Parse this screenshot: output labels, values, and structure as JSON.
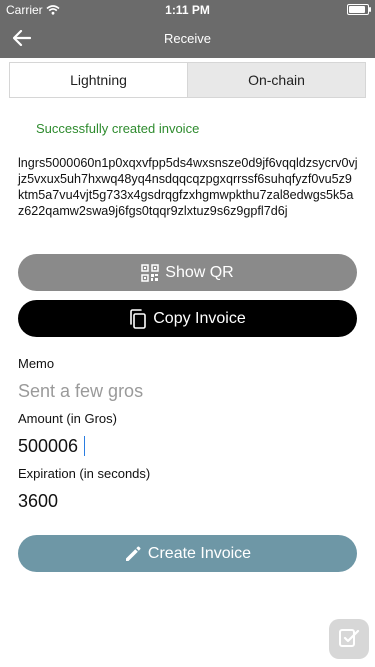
{
  "status_bar": {
    "carrier": "Carrier",
    "time": "1:11 PM"
  },
  "header": {
    "title": "Receive"
  },
  "tabs": [
    {
      "label": "Lightning",
      "active": true
    },
    {
      "label": "On-chain",
      "active": false
    }
  ],
  "message": {
    "success": "Successfully created invoice",
    "color": "#2e8b2e"
  },
  "invoice": {
    "text": "lngrs5000060n1p0xqxvfpp5ds4wxsnsze0d9jf6vqqldzsycrv0vjjz5vxux5uh7hxwq48yq4nsdqqcqzpgxqrrssf6suhqfyzf0vu5z9ktm5a7vu4vjt5g733x4gsdrqgfzxhgmwpkthu7zal8edwgs5k5az622qamw2swa9j6fgs0tqqr9zlxtuz9s6z9gpfl7d6j"
  },
  "actions": {
    "show_qr": "Show QR",
    "copy_invoice": "Copy Invoice",
    "create_invoice": "Create Invoice"
  },
  "form": {
    "memo_label": "Memo",
    "memo_placeholder": "Sent a few gros",
    "amount_label": "Amount (in Gros)",
    "amount_value": "500006",
    "expiration_label": "Expiration (in seconds)",
    "expiration_value": "3600"
  },
  "colors": {
    "header_bg": "#6b6b6b",
    "show_qr_bg": "#8a8a8a",
    "copy_bg": "#000000",
    "create_bg": "#6e97a6"
  },
  "icons": {
    "back": "arrow-left-icon",
    "qr": "qr-code-icon",
    "copy": "copy-icon",
    "create": "pencil-icon",
    "app": "app-badge-icon"
  }
}
